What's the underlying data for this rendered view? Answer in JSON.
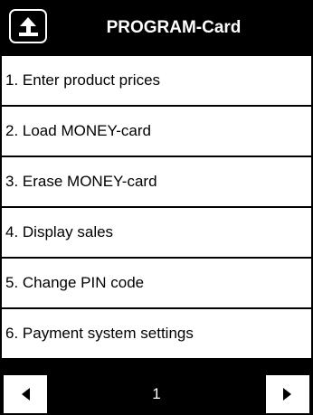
{
  "header": {
    "title": "PROGRAM-Card",
    "back_icon": "back-arrow-icon"
  },
  "menu": {
    "items": [
      {
        "label": "1. Enter product prices"
      },
      {
        "label": "2. Load MONEY-card"
      },
      {
        "label": "3. Erase MONEY-card"
      },
      {
        "label": "4. Display sales"
      },
      {
        "label": "5. Change PIN code"
      },
      {
        "label": "6. Payment system settings"
      }
    ]
  },
  "pager": {
    "page": "1",
    "prev_icon": "triangle-left-icon",
    "next_icon": "triangle-right-icon"
  },
  "colors": {
    "background": "#ffffff",
    "foreground": "#000000",
    "header_bg": "#000000",
    "header_text": "#ffffff"
  }
}
